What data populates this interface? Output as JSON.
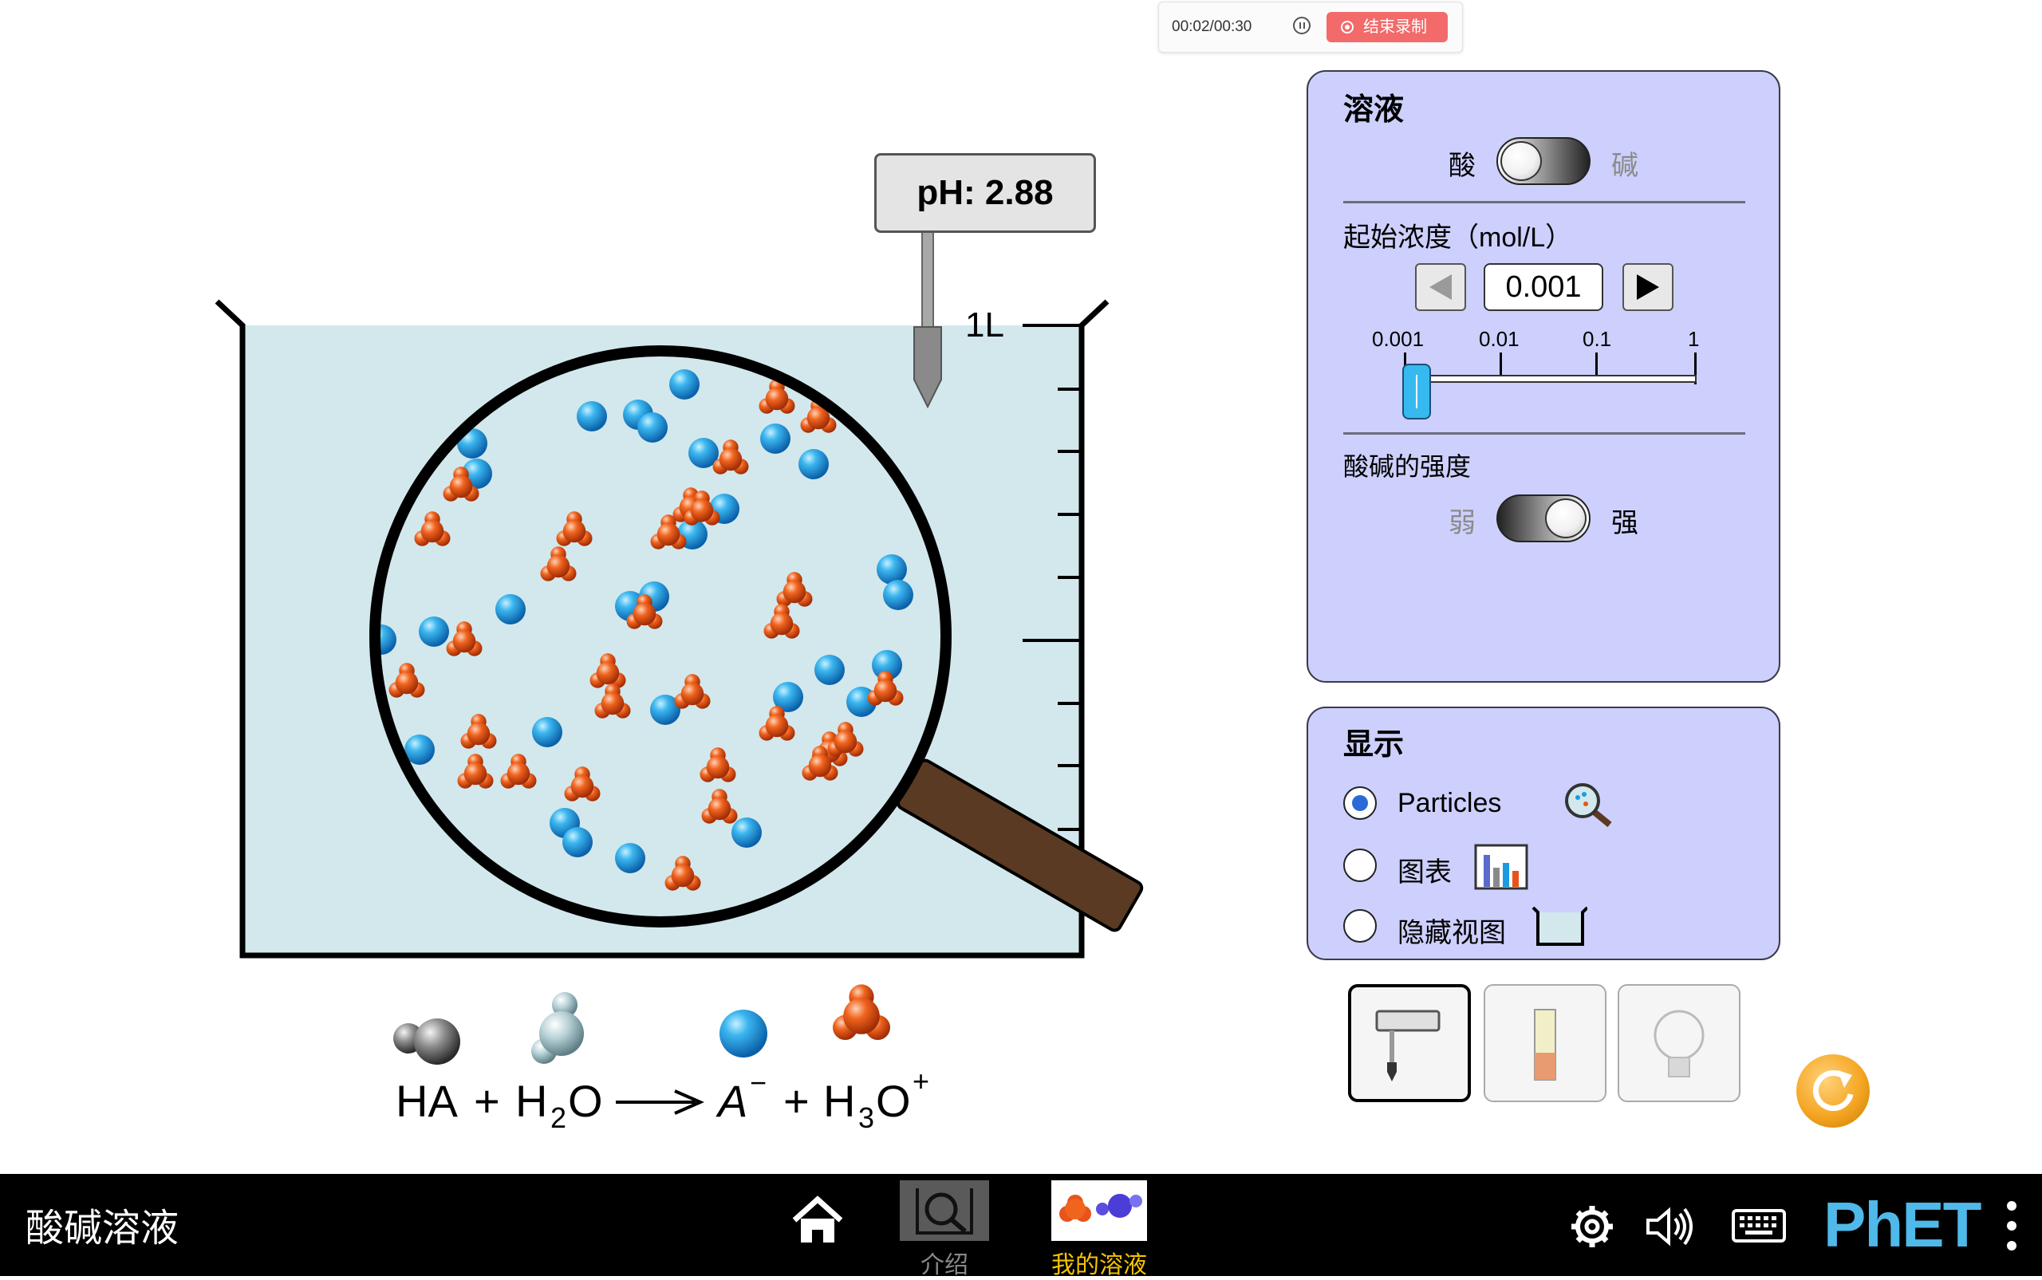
{
  "recording": {
    "time": "00:02/00:30",
    "stop_label": "结束录制"
  },
  "sim": {
    "ph_label": "pH: 2.88",
    "beaker_volume": "1L",
    "equation": {
      "ha": "HA",
      "plus": "+",
      "h2o": "H",
      "h2o_sub": "2",
      "h2o_tail": "O",
      "a": "A",
      "a_sup": "−",
      "h3o": "H",
      "h3o_sub": "3",
      "h3o_tail": "O",
      "h3o_sup": "+"
    }
  },
  "solution_panel": {
    "title": "溶液",
    "acid_label": "酸",
    "base_label": "碱",
    "concentration_title": "起始浓度（mol/L）",
    "concentration_value": "0.001",
    "slider_ticks": [
      "0.001",
      "0.01",
      "0.1",
      "1"
    ],
    "slider_value_fraction": 0.0,
    "strength_title": "酸碱的强度",
    "weak_label": "弱",
    "strong_label": "强"
  },
  "display_panel": {
    "title": "显示",
    "options": [
      {
        "label": "Particles",
        "selected": true,
        "icon": "magnifier-icon"
      },
      {
        "label": "图表",
        "selected": false,
        "icon": "bar-chart-icon"
      },
      {
        "label": "隐藏视图",
        "selected": false,
        "icon": "beaker-icon"
      }
    ]
  },
  "tools": [
    {
      "name": "ph-meter-tool",
      "selected": true
    },
    {
      "name": "ph-paper-tool",
      "selected": false
    },
    {
      "name": "lightbulb-tool",
      "selected": false
    }
  ],
  "navbar": {
    "title": "酸碱溶液",
    "screens": [
      {
        "label": "介绍",
        "selected": false
      },
      {
        "label": "我的溶液",
        "selected": true
      }
    ],
    "brand": "PhET"
  },
  "colors": {
    "panel_bg": "#cdd0fc",
    "solution": "#d2e8ec",
    "selected_screen_label": "#f5c400",
    "reset_button": "#f5a623",
    "anion": "#1a9be0",
    "hydronium": "#e8531c"
  }
}
